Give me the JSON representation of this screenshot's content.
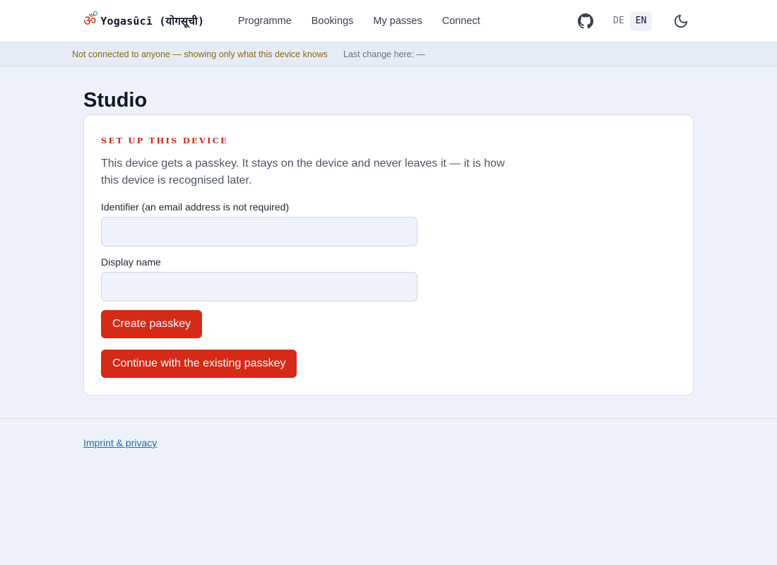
{
  "header": {
    "brand": {
      "logo_icon": "om-icon",
      "name": "Yogasūcī (योगसूची)"
    },
    "nav": [
      "Programme",
      "Bookings",
      "My passes",
      "Connect"
    ],
    "github_icon": "github-icon",
    "languages": {
      "options": [
        "DE",
        "EN"
      ],
      "active": "EN"
    },
    "theme_icon": "moon-icon"
  },
  "status": {
    "connection": "Not connected to anyone — showing only what this device knows",
    "last_change": "Last change here: —"
  },
  "main": {
    "title": "Studio",
    "card": {
      "kicker": "SET UP THIS DEVICE",
      "description": "This device gets a passkey. It stays on the device and never leaves it — it is how this device is recognised later.",
      "identifier_label": "Identifier (an email address is not required)",
      "identifier_value": "",
      "display_name_label": "Display name",
      "display_name_value": "",
      "create_button": "Create passkey",
      "continue_button": "Continue with the existing passkey"
    }
  },
  "footer": {
    "link": "Imprint & privacy"
  },
  "colors": {
    "accent": "#d42a17",
    "background": "#edf2fa",
    "link": "#1d6fa6",
    "warning_text": "#8a6a14"
  }
}
